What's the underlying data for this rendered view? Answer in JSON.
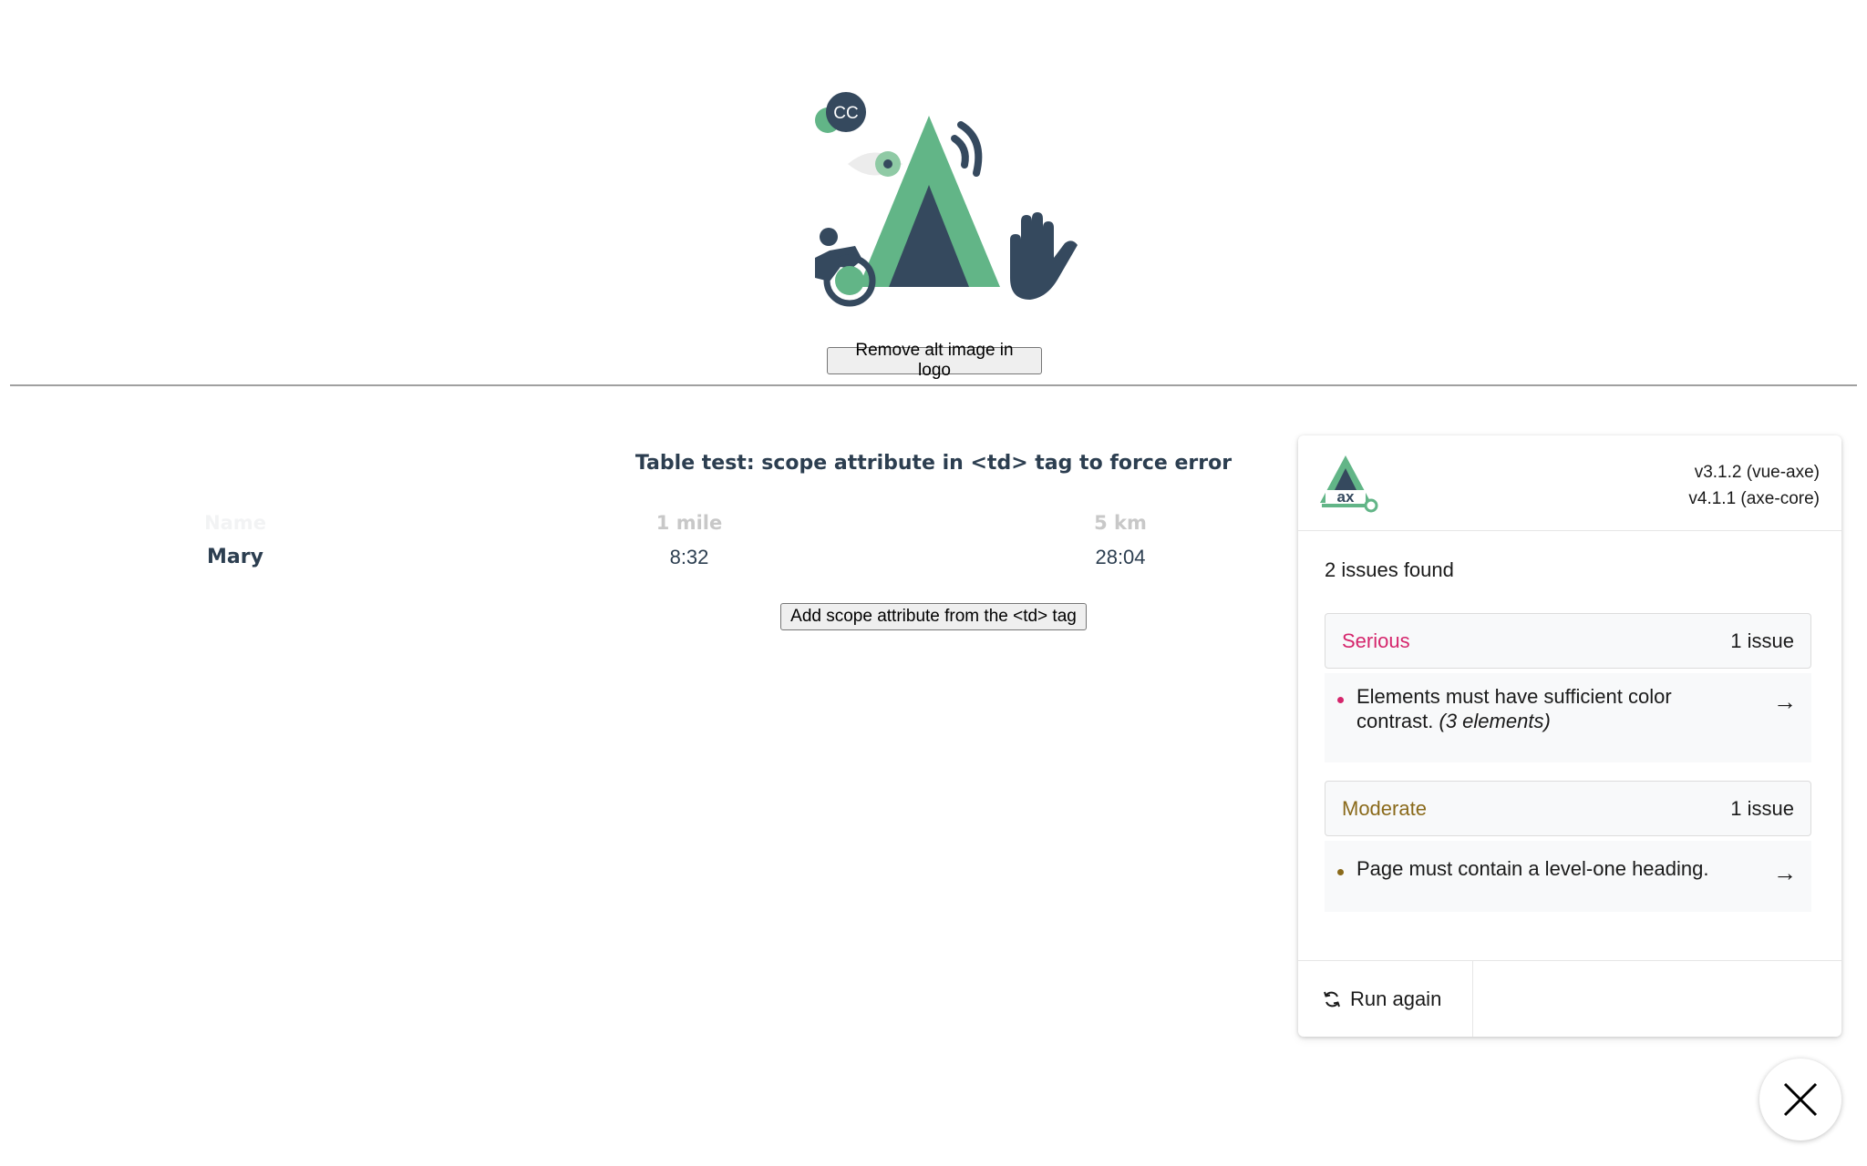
{
  "hero": {
    "logo_badge": "CC",
    "remove_alt_button": "Remove alt image in logo"
  },
  "table": {
    "caption": "Table test: scope attribute in <td> tag to force error",
    "headers": [
      "Name",
      "1 mile",
      "5 km"
    ],
    "row": {
      "name": "Mary",
      "mile": "8:32",
      "km": "28:04"
    },
    "add_scope_button": "Add scope attribute from the <td> tag"
  },
  "axe_panel": {
    "logo_text": "ax",
    "version_vue_axe": "v3.1.2 (vue-axe)",
    "version_axe_core": "v4.1.1 (axe-core)",
    "summary": "2 issues found",
    "groups": [
      {
        "impact": "Serious",
        "count_label": "1 issue",
        "color": "#d5266c",
        "issue_text": "Elements must have sufficient color contrast.",
        "issue_note": "(3 elements)"
      },
      {
        "impact": "Moderate",
        "count_label": "1 issue",
        "color": "#8a6a1b",
        "issue_text": "Page must contain a level-one heading.",
        "issue_note": ""
      }
    ],
    "run_again": "Run again",
    "icons": {
      "arrow": "arrow-right-icon",
      "refresh": "refresh-icon",
      "close": "close-icon"
    }
  },
  "colors": {
    "green": "#62b587",
    "navy": "#35495e",
    "text": "#2c3e50"
  }
}
